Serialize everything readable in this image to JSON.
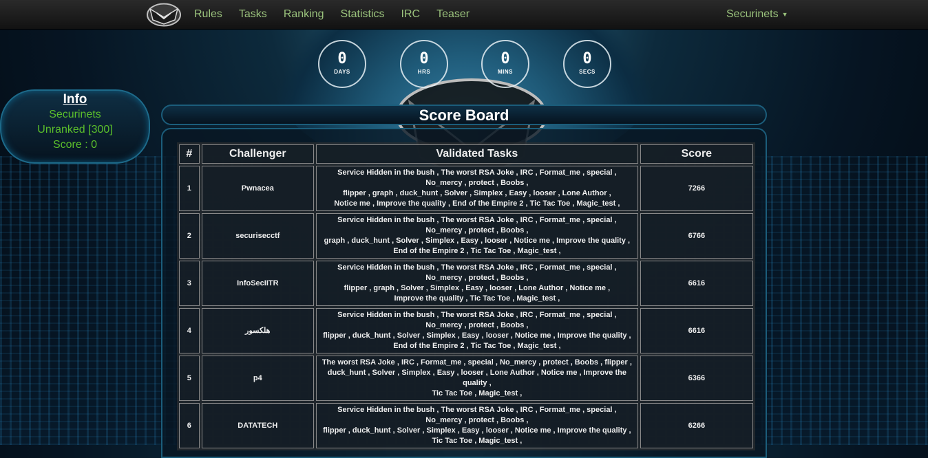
{
  "navbar": {
    "links": [
      "Rules",
      "Tasks",
      "Ranking",
      "Statistics",
      "IRC",
      "Teaser"
    ],
    "user": "Securinets"
  },
  "countdown": [
    {
      "value": "0",
      "label": "DAYS"
    },
    {
      "value": "0",
      "label": "HRS"
    },
    {
      "value": "0",
      "label": "MINS"
    },
    {
      "value": "0",
      "label": "SECS"
    }
  ],
  "info": {
    "title": "Info",
    "team": "Securinets",
    "rank": "Unranked [300]",
    "score": "Score : 0"
  },
  "scoreboard": {
    "title": "Score Board",
    "columns": [
      "#",
      "Challenger",
      "Validated Tasks",
      "Score"
    ],
    "rows": [
      {
        "rank": "1",
        "name": "Pwnacea",
        "score": "7266",
        "tasks": [
          "Service Hidden in the bush , The worst RSA Joke , IRC , Format_me , special , No_mercy , protect , Boobs ,",
          "flipper , graph , duck_hunt , Solver , Simplex , Easy , looser , Lone Author ,",
          "Notice me , Improve the quality , End of the Empire 2 , Tic Tac Toe , Magic_test ,"
        ]
      },
      {
        "rank": "2",
        "name": "securisecctf",
        "score": "6766",
        "tasks": [
          "Service Hidden in the bush , The worst RSA Joke , IRC , Format_me , special , No_mercy , protect , Boobs ,",
          "graph , duck_hunt , Solver , Simplex , Easy , looser , Notice me , Improve the quality ,",
          "End of the Empire 2 , Tic Tac Toe , Magic_test ,"
        ]
      },
      {
        "rank": "3",
        "name": "InfoSecIITR",
        "score": "6616",
        "tasks": [
          "Service Hidden in the bush , The worst RSA Joke , IRC , Format_me , special , No_mercy , protect , Boobs ,",
          "flipper , graph , Solver , Simplex , Easy , looser , Lone Author , Notice me ,",
          "Improve the quality , Tic Tac Toe , Magic_test ,"
        ]
      },
      {
        "rank": "4",
        "name": "هلكسور",
        "score": "6616",
        "tasks": [
          "Service Hidden in the bush , The worst RSA Joke , IRC , Format_me , special , No_mercy , protect , Boobs ,",
          "flipper , duck_hunt , Solver , Simplex , Easy , looser , Notice me , Improve the quality ,",
          "End of the Empire 2 , Tic Tac Toe , Magic_test ,"
        ]
      },
      {
        "rank": "5",
        "name": "p4",
        "score": "6366",
        "tasks": [
          "The worst RSA Joke , IRC , Format_me , special , No_mercy , protect , Boobs , flipper , duck_hunt , Solver , Simplex , Easy , looser , Lone Author , Notice me , Improve the quality ,",
          "Tic Tac Toe , Magic_test ,"
        ]
      },
      {
        "rank": "6",
        "name": "DATATECH",
        "score": "6266",
        "tasks": [
          "Service Hidden in the bush , The worst RSA Joke , IRC , Format_me , special , No_mercy , protect , Boobs ,",
          "flipper , duck_hunt , Solver , Simplex , Easy , looser , Notice me , Improve the quality ,",
          "Tic Tac Toe , Magic_test ,"
        ]
      }
    ]
  }
}
